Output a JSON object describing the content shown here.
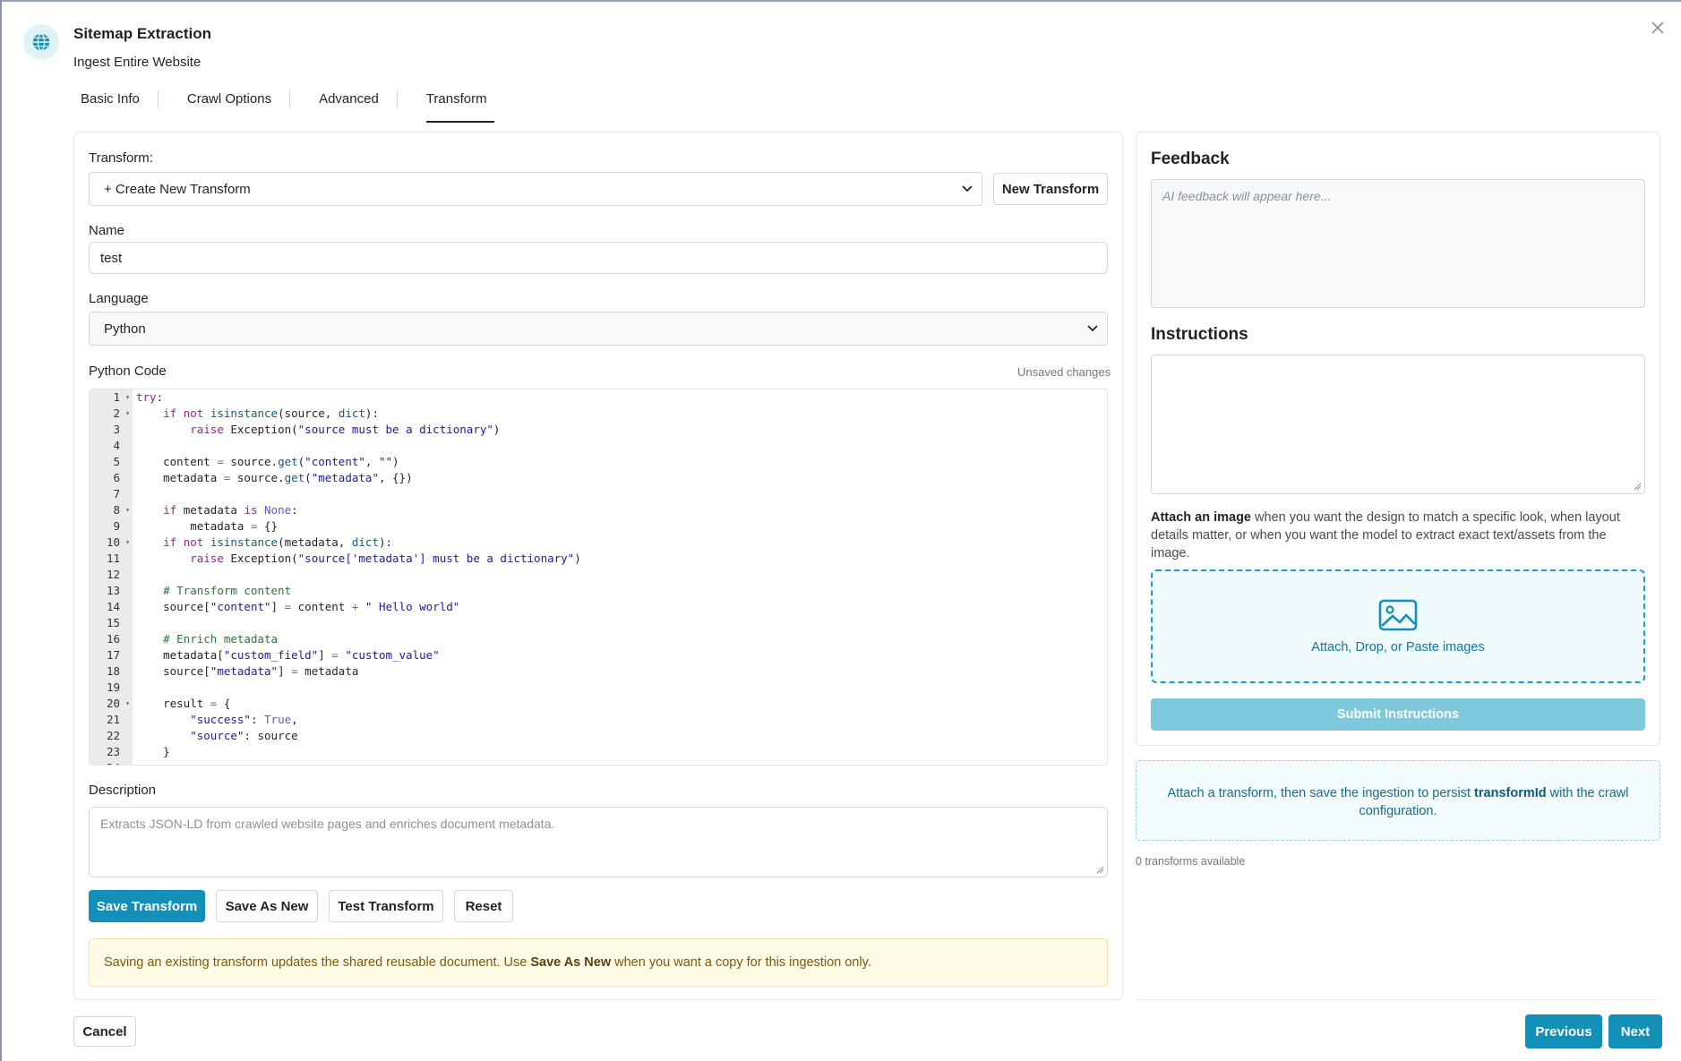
{
  "header": {
    "title": "Sitemap Extraction",
    "subtitle": "Ingest Entire Website"
  },
  "tabs": [
    {
      "label": "Basic Info",
      "active": false
    },
    {
      "label": "Crawl Options",
      "active": false
    },
    {
      "label": "Advanced",
      "active": false
    },
    {
      "label": "Transform",
      "active": true
    }
  ],
  "transform": {
    "label": "Transform:",
    "selected": "+ Create New Transform",
    "new_button": "New Transform"
  },
  "name": {
    "label": "Name",
    "value": "test"
  },
  "language": {
    "label": "Language",
    "selected": "Python"
  },
  "code": {
    "label": "Python Code",
    "status": "Unsaved changes",
    "lines": [
      "try:",
      "    if not isinstance(source, dict):",
      "        raise Exception(\"source must be a dictionary\")",
      "",
      "    content = source.get(\"content\", \"\")",
      "    metadata = source.get(\"metadata\", {})",
      "",
      "    if metadata is None:",
      "        metadata = {}",
      "    if not isinstance(metadata, dict):",
      "        raise Exception(\"source['metadata'] must be a dictionary\")",
      "",
      "    # Transform content",
      "    source[\"content\"] = content + \" Hello world\"",
      "",
      "    # Enrich metadata",
      "    metadata[\"custom_field\"] = \"custom_value\"",
      "    source[\"metadata\"] = metadata",
      "",
      "    result = {",
      "        \"success\": True,",
      "        \"source\": source",
      "    }"
    ],
    "fold_lines": [
      1,
      2,
      8,
      10,
      20
    ]
  },
  "description": {
    "label": "Description",
    "placeholder": "Extracts JSON-LD from crawled website pages and enriches document metadata."
  },
  "actions": {
    "save": "Save Transform",
    "save_as_new": "Save As New",
    "test": "Test Transform",
    "reset": "Reset"
  },
  "notice": {
    "before": "Saving an existing transform updates the shared reusable document. Use ",
    "bold": "Save As New",
    "after": " when you want a copy for this ingestion only."
  },
  "feedback": {
    "title": "Feedback",
    "placeholder": "AI feedback will appear here..."
  },
  "instructions": {
    "title": "Instructions",
    "attach_bold": "Attach an image",
    "attach_rest": " when you want the design to match a specific look, when layout details matter, or when you want the model to extract exact text/assets from the image.",
    "dropzone_label": "Attach, Drop, or Paste images",
    "submit": "Submit Instructions"
  },
  "info": {
    "before": "Attach a transform, then save the ingestion to persist ",
    "bold": "transformId",
    "after": " with the crawl configuration."
  },
  "transforms_count": "0 transforms available",
  "footer": {
    "cancel": "Cancel",
    "previous": "Previous",
    "next": "Next"
  },
  "colors": {
    "primary": "#1290b8",
    "primary_disabled": "#7ec9dc",
    "notice_bg": "#fefbe6",
    "dropzone_border": "#1ba0c4"
  }
}
